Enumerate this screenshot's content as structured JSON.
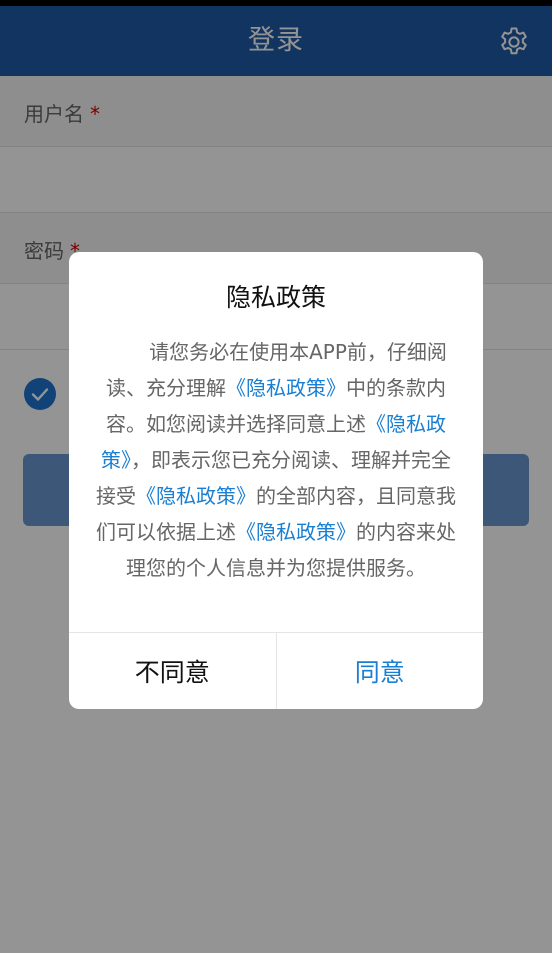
{
  "header": {
    "title": "登录",
    "settings_icon": "gear-icon",
    "background_color": "#1f5aa6"
  },
  "login_form": {
    "username_label": "用户名",
    "password_label": "密码",
    "required_marker": "*",
    "username_value": "",
    "password_value": "",
    "remember_checkbox_checked": true,
    "login_button_label": ""
  },
  "privacy_dialog": {
    "title": "隐私政策",
    "body_segments": [
      {
        "text": "请您务必在使用本APP前，仔细阅读、充分理解",
        "link": false
      },
      {
        "text": "《隐私政策》",
        "link": true
      },
      {
        "text": "中的条款内容。如您阅读并选择同意上述",
        "link": false
      },
      {
        "text": "《隐私政策》",
        "link": true
      },
      {
        "text": "，即表示您已充分阅读、理解并完全接受",
        "link": false
      },
      {
        "text": "《隐私政策》",
        "link": true
      },
      {
        "text": "的全部内容，且同意我们可以依据上述",
        "link": false
      },
      {
        "text": "《隐私政策》",
        "link": true
      },
      {
        "text": "的内容来处理您的个人信息并为您提供服务。",
        "link": false
      }
    ],
    "disagree_label": "不同意",
    "agree_label": "同意"
  },
  "colors": {
    "accent": "#1a7fd2",
    "required": "#d40000",
    "overlay": "rgba(0,0,0,0.42)"
  }
}
